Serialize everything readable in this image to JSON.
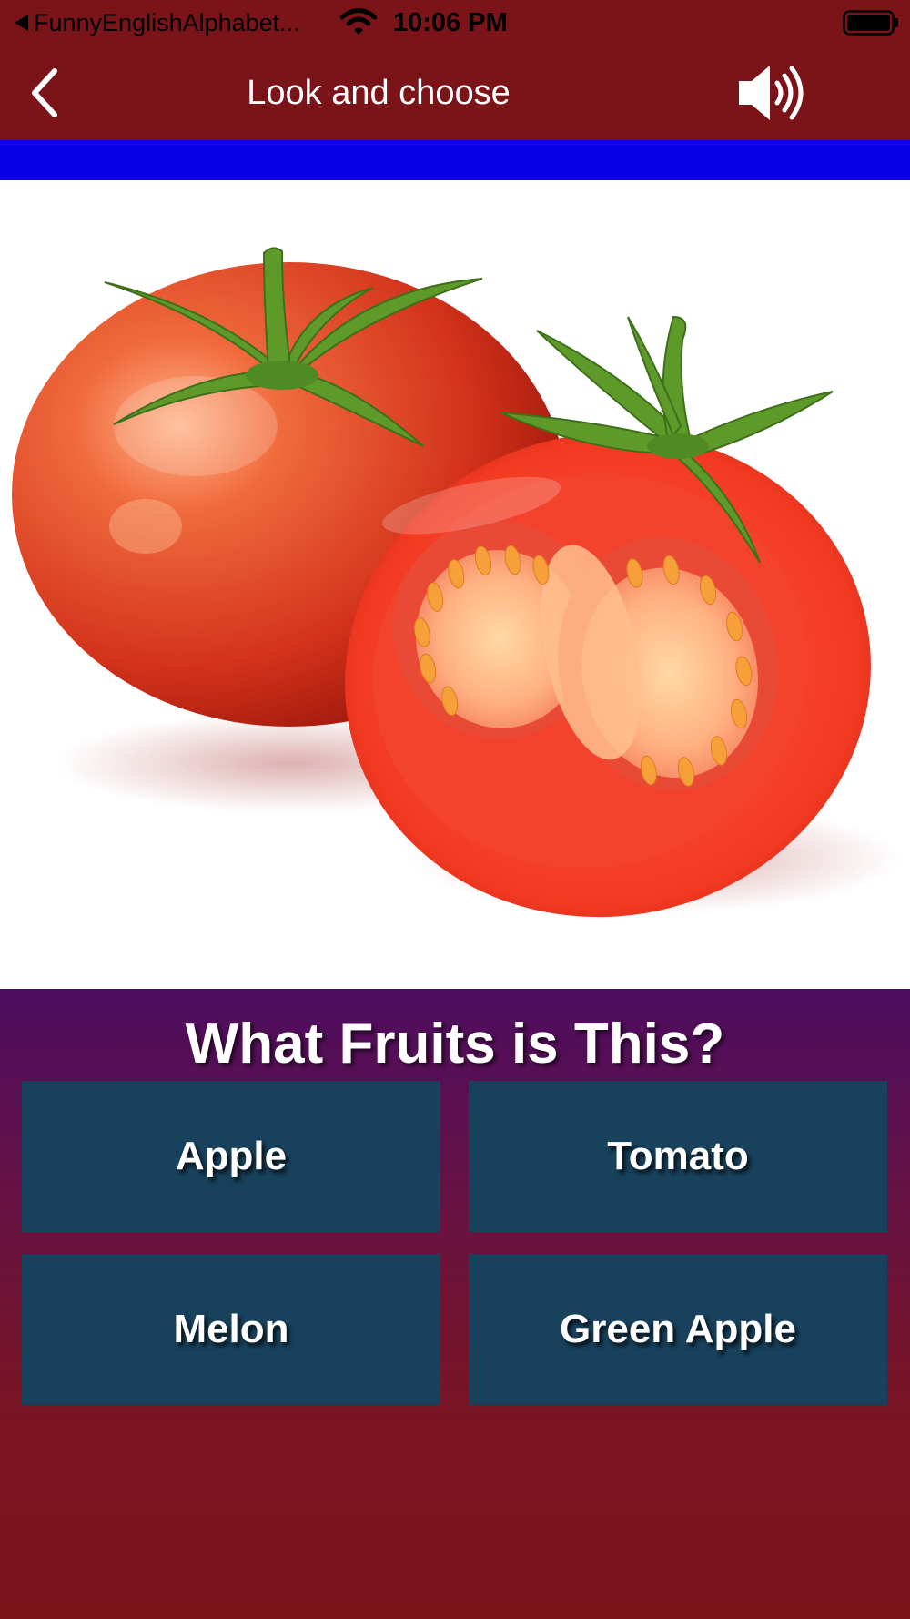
{
  "status_bar": {
    "back_app_label": "FunnyEnglishAlphabet...",
    "time": "10:06 PM"
  },
  "nav": {
    "title": "Look and choose",
    "back_icon": "chevron-left-icon",
    "sound_icon": "speaker-icon"
  },
  "image": {
    "subject": "tomato"
  },
  "quiz": {
    "question": "What Fruits is This?",
    "answers": [
      "Apple",
      "Tomato",
      "Melon",
      "Green Apple"
    ]
  },
  "colors": {
    "header_bg": "#7b1419",
    "progress_strip": "#0800e8",
    "answer_button_bg": "#18415c",
    "quiz_bg_top": "#4d0d60"
  }
}
